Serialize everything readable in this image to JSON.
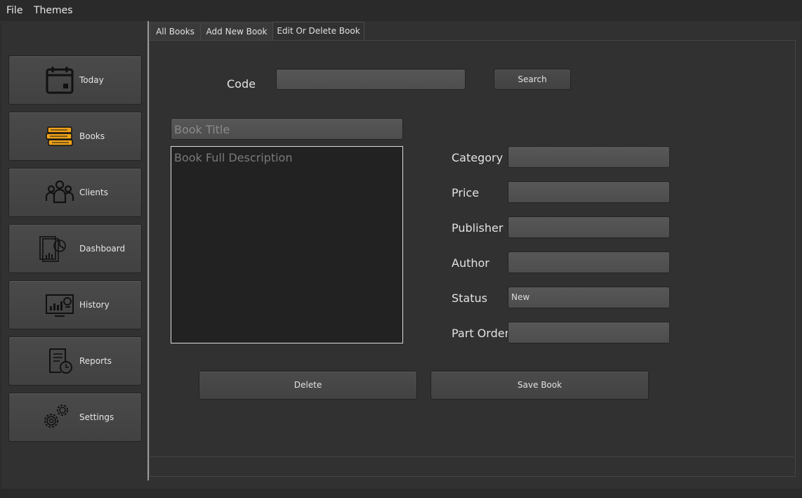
{
  "menu": {
    "file": "File",
    "themes": "Themes"
  },
  "sidebar": {
    "items": [
      {
        "label": "Today",
        "icon": "calendar-icon"
      },
      {
        "label": "Books",
        "icon": "books-icon"
      },
      {
        "label": "Clients",
        "icon": "clients-icon"
      },
      {
        "label": "Dashboard",
        "icon": "dashboard-icon"
      },
      {
        "label": "History",
        "icon": "history-icon"
      },
      {
        "label": "Reports",
        "icon": "reports-icon"
      },
      {
        "label": "Settings",
        "icon": "settings-icon"
      }
    ]
  },
  "tabs": [
    {
      "label": "All Books"
    },
    {
      "label": "Add New Book"
    },
    {
      "label": "Edit Or Delete Book"
    }
  ],
  "form": {
    "code_label": "Code",
    "code_value": "",
    "search_label": "Search",
    "title_placeholder": "Book Title",
    "description_placeholder": "Book Full Description",
    "category_label": "Category",
    "price_label": "Price",
    "publisher_label": "Publisher",
    "author_label": "Author",
    "status_label": "Status",
    "status_value": "New",
    "part_order_label": "Part Order",
    "delete_label": "Delete",
    "save_label": "Save Book"
  },
  "colors": {
    "accent_books": "#f0a21a",
    "icon_dark": "#111111"
  }
}
